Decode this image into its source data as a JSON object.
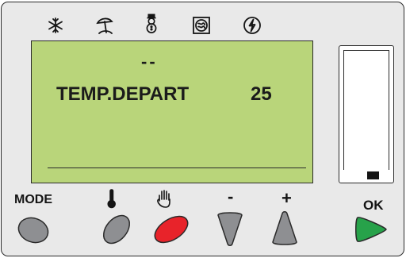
{
  "mode_icons": [
    {
      "name": "frost-icon"
    },
    {
      "name": "vacation-icon"
    },
    {
      "name": "snowman-icon"
    },
    {
      "name": "boiler-icon"
    },
    {
      "name": "lightning-icon"
    }
  ],
  "display": {
    "top": "--",
    "parameter": "TEMP.DEPART",
    "value": "25"
  },
  "buttons": {
    "mode_label": "MODE",
    "minus_label": "-",
    "plus_label": "+",
    "ok_label": "OK"
  },
  "colors": {
    "lcd_background": "#b9d57a",
    "panel": "#e9e9e9",
    "button_gray": "#8e8f92",
    "button_red": "#e8232a",
    "button_green": "#27a24a"
  }
}
